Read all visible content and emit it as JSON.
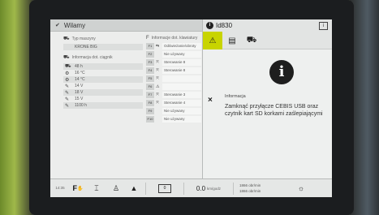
{
  "left_panel": {
    "header_title": "Wilamy",
    "machine_type": {
      "label": "Typ maszyny",
      "value": "KRONE BIG"
    },
    "info_section": {
      "label": "Informacja dot. ciągnik",
      "rows": [
        {
          "icon": "tractor-icon",
          "glyph": "⛟",
          "value": "48 h"
        },
        {
          "icon": "gear-icon",
          "glyph": "⚙",
          "value": "16 °C"
        },
        {
          "icon": "gear-icon",
          "glyph": "⚙",
          "value": "14 °C"
        },
        {
          "icon": "wrench-icon",
          "glyph": "✎",
          "value": "14 V"
        },
        {
          "icon": "wrench-icon",
          "glyph": "✎",
          "value": "18 V"
        },
        {
          "icon": "wrench-icon",
          "glyph": "✎",
          "value": "15 V"
        },
        {
          "icon": "wrench-icon",
          "glyph": "✎",
          "value": "1100 h"
        }
      ]
    },
    "functions_section": {
      "label": "Informacje dot. klawiatury",
      "rows": [
        {
          "num": "F1",
          "glyph": "⇆",
          "label": "Odświeżanie/obroty"
        },
        {
          "num": "F2",
          "glyph": "",
          "label": "Nie używany"
        },
        {
          "num": "F3",
          "glyph": "⤧",
          "label": "Sterowanie 8"
        },
        {
          "num": "F4",
          "glyph": "⤧",
          "label": "Sterowanie 8"
        },
        {
          "num": "F5",
          "glyph": "⤧",
          "label": ""
        },
        {
          "num": "F6",
          "glyph": "⚠",
          "label": ""
        },
        {
          "num": "F7",
          "glyph": "⤧",
          "label": "Sterowanie 3"
        },
        {
          "num": "F8",
          "glyph": "⤧",
          "label": "Sterowanie 4"
        },
        {
          "num": "F9",
          "glyph": "",
          "label": "Nie używany"
        },
        {
          "num": "F10",
          "glyph": "",
          "label": "Nie używany"
        }
      ]
    }
  },
  "right_panel": {
    "header_code": "Id830",
    "header_badge": "i",
    "info_button": "i",
    "tabs": [
      {
        "glyph": "⚠",
        "icon": "warning-tab-icon",
        "active": true
      },
      {
        "glyph": "▤",
        "icon": "document-tab-icon",
        "active": false
      },
      {
        "glyph": "⛟",
        "icon": "machine-tab-icon",
        "active": false
      }
    ],
    "big_icon_glyph": "i",
    "close_glyph": "×",
    "message_title": "Informacja",
    "message_body": "Zamknąć przyłącze CEBIS USB oraz czytnik kart SD korkami zaślepiającymi"
  },
  "bottom_bar": {
    "time": "14:35",
    "f_label": "F",
    "speed_value": "0.0",
    "speed_unit": "km/godz",
    "hours_1": "1866 obr/min",
    "hours_2": "1866 obr/min",
    "center_label": "0"
  }
}
